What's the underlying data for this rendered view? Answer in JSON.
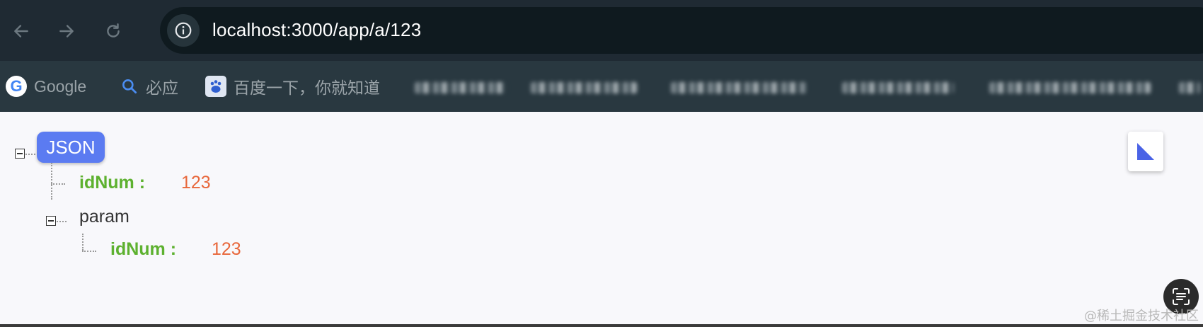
{
  "browser": {
    "url": "localhost:3000/app/a/123"
  },
  "bookmarks": [
    {
      "label": "Google"
    },
    {
      "label": "必应"
    },
    {
      "label": "百度一下，你就知道"
    }
  ],
  "json_viewer": {
    "root_label": "JSON",
    "items": [
      {
        "key": "idNum :",
        "value": "123"
      },
      {
        "key": "param"
      },
      {
        "key": "idNum :",
        "value": "123"
      }
    ]
  },
  "watermark": "@稀土掘金技术社区",
  "colors": {
    "badge": "#5b7bf1",
    "key": "#5db12f",
    "value": "#e8673b"
  }
}
